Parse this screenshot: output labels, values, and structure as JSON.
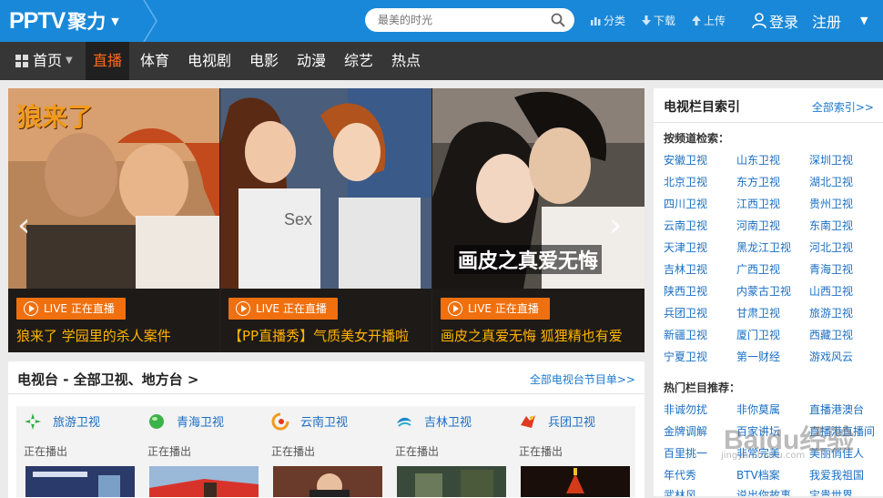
{
  "header": {
    "logo_pp": "PPTV",
    "logo_jl": "聚力",
    "search_placeholder": "最美的时光",
    "links": {
      "category": "分类",
      "download": "下载",
      "upload": "上传"
    },
    "login": "登录",
    "register": "注册"
  },
  "nav": {
    "home": "首页",
    "items": [
      "直播",
      "体育",
      "电视剧",
      "电影",
      "动漫",
      "综艺",
      "热点"
    ],
    "active": "直播"
  },
  "banner": {
    "live_label": "LIVE 正在直播",
    "slides": [
      {
        "overlay_title": "狼来了",
        "caption": "狼来了 学园里的杀人案件"
      },
      {
        "overlay_title": "Sexy",
        "caption": "【PP直播秀】气质美女开播啦"
      },
      {
        "overlay_title": "画皮之真爱无悔",
        "caption": "画皮之真爱无悔 狐狸精也有爱"
      }
    ]
  },
  "tv_section": {
    "title": "电视台 - 全部卫视、地方台 >",
    "more": "全部电视台节目单>>",
    "playing_label": "正在播出",
    "cards": [
      {
        "name": "旅游卫视",
        "icon": "tourism-tv-icon",
        "color": "#2eaa3c"
      },
      {
        "name": "青海卫视",
        "icon": "qinghai-tv-icon",
        "color": "#3bb34a"
      },
      {
        "name": "云南卫视",
        "icon": "yunnan-tv-icon",
        "color": "#f29a1a"
      },
      {
        "name": "吉林卫视",
        "icon": "jilin-tv-icon",
        "color": "#1f88c9"
      },
      {
        "name": "兵团卫视",
        "icon": "bingtuan-tv-icon",
        "color": "#e23a1e"
      }
    ]
  },
  "sidebar": {
    "title": "电视栏目索引",
    "more": "全部索引>>",
    "by_channel": "按频道检索：",
    "channels": [
      [
        "安徽卫视",
        "山东卫视",
        "深圳卫视"
      ],
      [
        "北京卫视",
        "东方卫视",
        "湖北卫视"
      ],
      [
        "四川卫视",
        "江西卫视",
        "贵州卫视"
      ],
      [
        "云南卫视",
        "河南卫视",
        "东南卫视"
      ],
      [
        "天津卫视",
        "黑龙江卫视",
        "河北卫视"
      ],
      [
        "吉林卫视",
        "广西卫视",
        "青海卫视"
      ],
      [
        "陕西卫视",
        "内蒙古卫视",
        "山西卫视"
      ],
      [
        "兵团卫视",
        "甘肃卫视",
        "旅游卫视"
      ],
      [
        "新疆卫视",
        "厦门卫视",
        "西藏卫视"
      ],
      [
        "宁夏卫视",
        "第一财经",
        "游戏风云"
      ]
    ],
    "hot_title": "热门栏目推荐：",
    "hot": [
      [
        "非诚勿扰",
        "非你莫属",
        "直播港澳台"
      ],
      [
        "金牌调解",
        "百家讲坛",
        "直播港直播间"
      ],
      [
        "百里挑一",
        "非常完美",
        "美丽俏佳人"
      ],
      [
        "年代秀",
        "BTV档案",
        "我爱我祖国"
      ],
      [
        "武林风",
        "说出你故事",
        "宝贵世界"
      ]
    ]
  },
  "watermark": {
    "main": "Baidu经验",
    "sub": "jingyan.baidu.com"
  }
}
